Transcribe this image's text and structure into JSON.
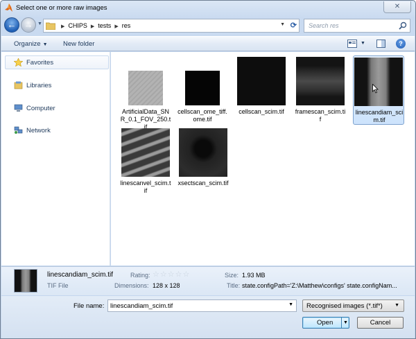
{
  "window": {
    "title": "Select one or more raw images",
    "close_label": "✕"
  },
  "address": {
    "crumbs": [
      "CHIPS",
      "tests",
      "res"
    ],
    "search_placeholder": "Search res"
  },
  "toolbar": {
    "organize_label": "Organize",
    "new_folder_label": "New folder"
  },
  "navpane": {
    "items": [
      {
        "label": "Favorites",
        "icon": "star-icon"
      },
      {
        "label": "Libraries",
        "icon": "libraries-icon"
      },
      {
        "label": "Computer",
        "icon": "computer-icon"
      },
      {
        "label": "Network",
        "icon": "network-icon"
      }
    ]
  },
  "files": [
    {
      "name": "ArtificialData_SNR_0.1_FOV_250.tif",
      "thumb": "gray-diagonal-texture"
    },
    {
      "name": "cellscan_ome_tiff.ome.tif",
      "thumb": "black"
    },
    {
      "name": "cellscan_scim.tif",
      "thumb": "black"
    },
    {
      "name": "framescan_scim.tif",
      "thumb": "horizontal-band"
    },
    {
      "name": "linescandiam_scim.tif",
      "thumb": "vertical-band",
      "selected": true
    },
    {
      "name": "linescanvel_scim.tif",
      "thumb": "diagonal-stripes"
    },
    {
      "name": "xsectscan_scim.tif",
      "thumb": "dark-cross-section"
    }
  ],
  "details": {
    "name": "linescandiam_scim.tif",
    "type": "TIF File",
    "rating_label": "Rating:",
    "rating_stars": "☆☆☆☆☆",
    "dimensions_label": "Dimensions:",
    "dimensions_value": "128 x 128",
    "size_label": "Size:",
    "size_value": "1.93 MB",
    "title_label": "Title:",
    "title_value": "state.configPath='Z:\\Matthew\\configs' state.configNam..."
  },
  "bottom": {
    "file_name_label": "File name:",
    "file_name_value": "linescandiam_scim.tif",
    "filter_value": "Recognised images (*.tif*)",
    "open_label": "Open",
    "cancel_label": "Cancel"
  }
}
